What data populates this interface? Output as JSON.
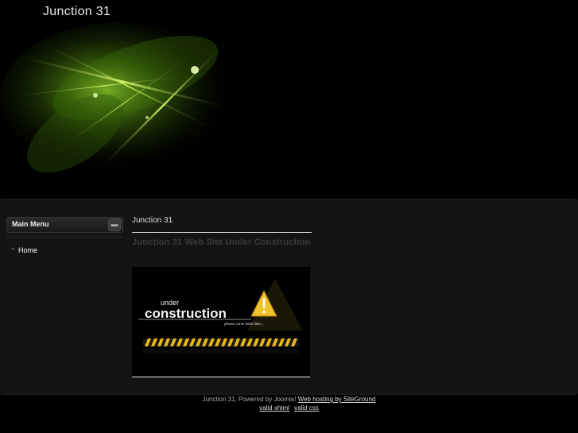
{
  "header": {
    "site_title": "Junction 31"
  },
  "menu": {
    "title": "Main Menu",
    "toggle_icon": "toggle-icon",
    "items": [
      {
        "label": "Home"
      }
    ]
  },
  "content": {
    "breadcrumb": "Junction 31",
    "article_title": "Junction 31 Web Site Under Construction",
    "image": {
      "word_small": "under",
      "word_big": "construction",
      "tagline": "please come back later...",
      "warning_icon": "warning-icon"
    }
  },
  "footer": {
    "text": "Junction 31, Powered by Joomla!",
    "hosting_link": "Web hosting by SiteGround",
    "valid_xhtml": "valid xhtml",
    "valid_css": "valid css"
  },
  "colors": {
    "background": "#000000",
    "panel": "#141414",
    "accent_green": "#8fd11a"
  }
}
